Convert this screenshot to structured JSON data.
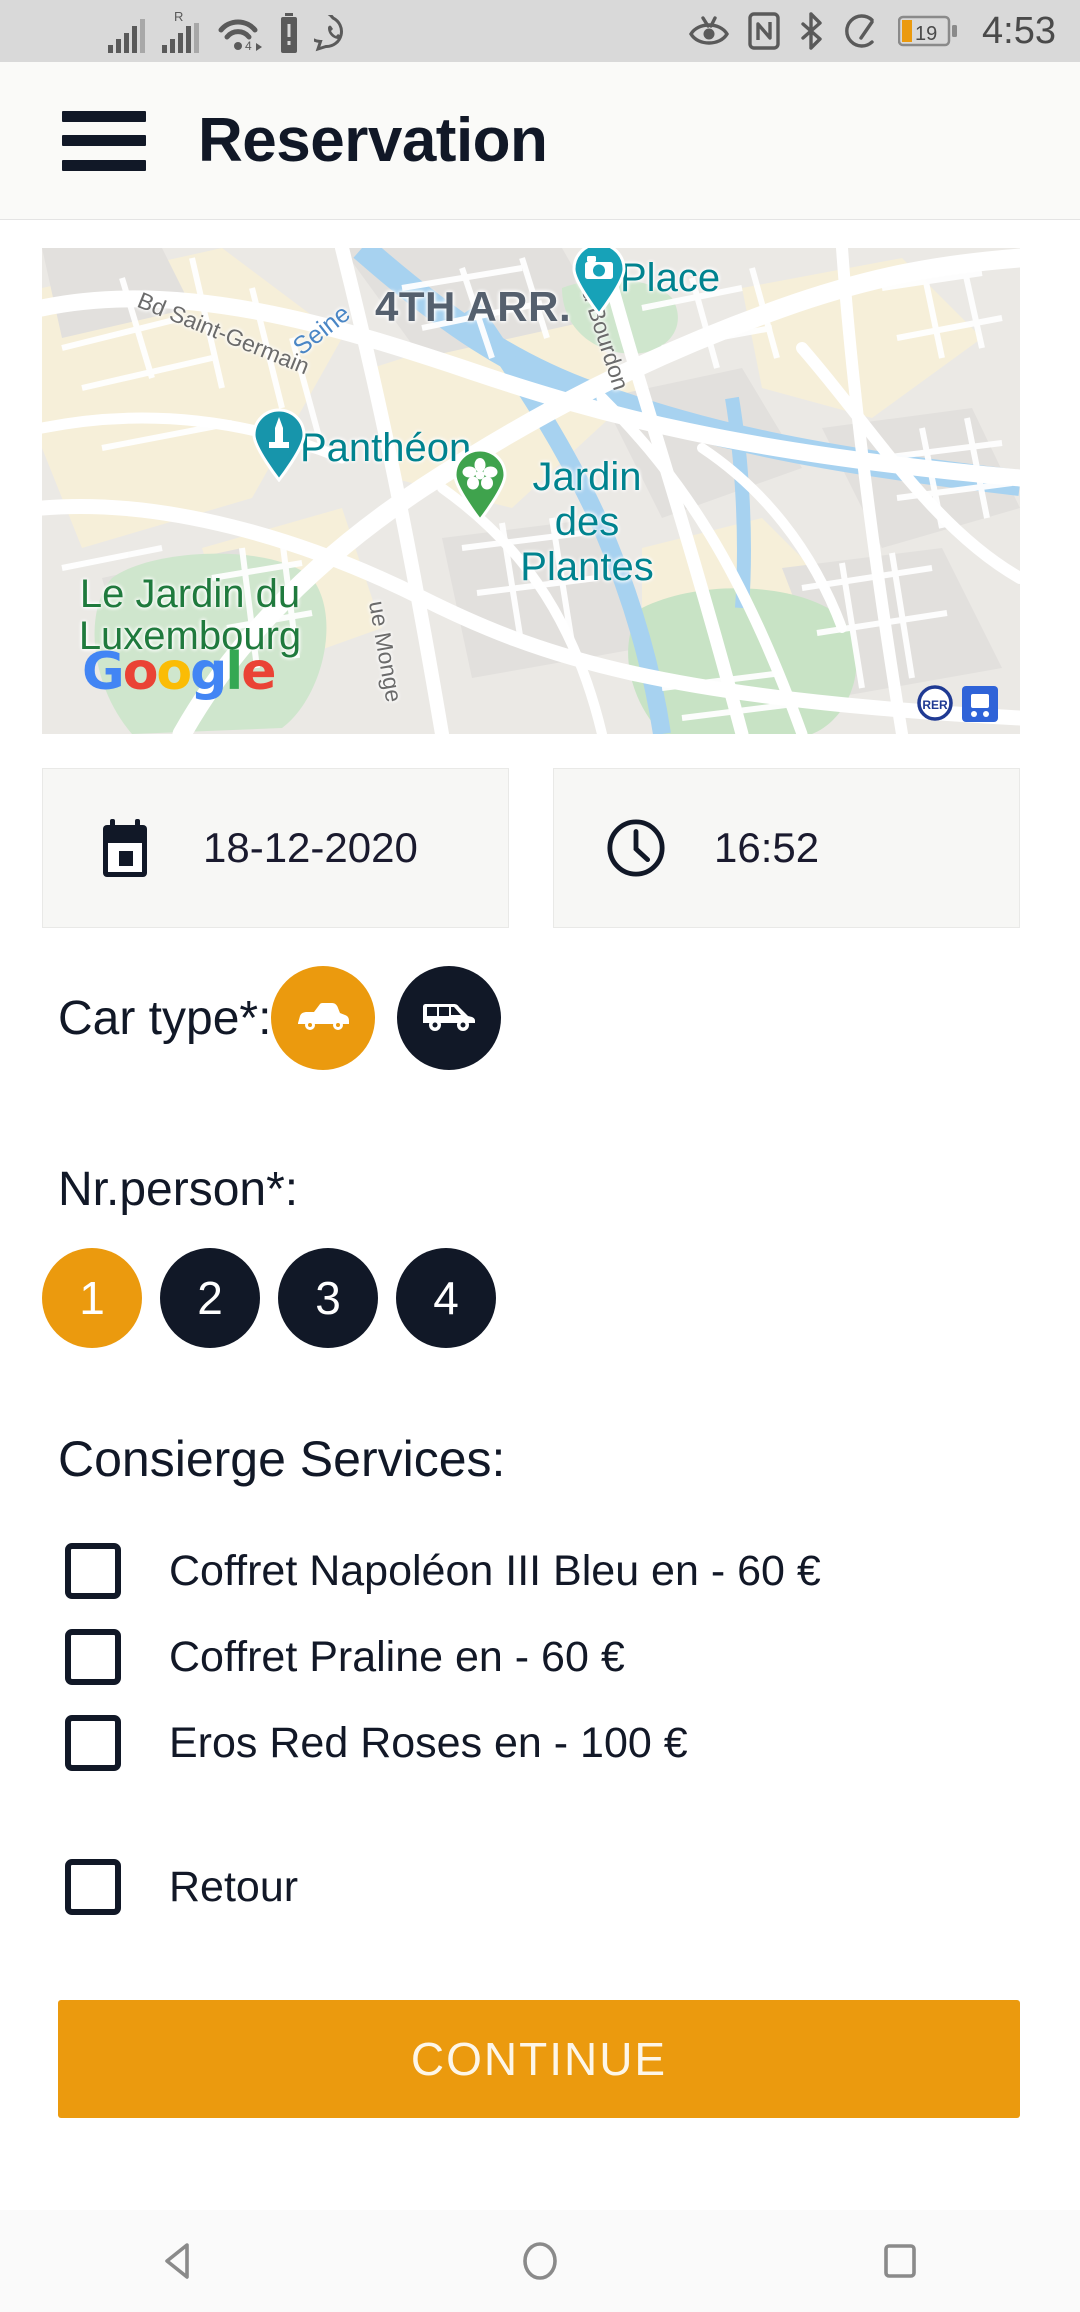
{
  "status_bar": {
    "time": "4:53",
    "battery_percent": "19",
    "icons": [
      "signal-bars-icon",
      "roaming-signal-bars-icon",
      "wifi-4g-icon",
      "battery-alert-icon",
      "whatsapp-icon",
      "eye-comfort-icon",
      "nfc-icon",
      "bluetooth-icon",
      "data-saver-icon",
      "battery-icon"
    ]
  },
  "header": {
    "title": "Reservation",
    "menu_icon": "hamburger-menu-icon"
  },
  "map": {
    "provider_logo": {
      "g1": "G",
      "o1": "o",
      "o2": "o",
      "g2": "g",
      "l": "l",
      "e": "e"
    },
    "labels": {
      "arrondissement": "4TH ARR.",
      "river": "Seine",
      "street_saint_germain": "Bd Saint-Germain",
      "street_bourdon": "Bd Bourdon",
      "street_monge": "ue Monge",
      "park_luxembourg": "Le Jardin du Luxembourg",
      "poi_pantheon": "Panthéon",
      "poi_place": "Place",
      "poi_jardin_plantes": "Jardin des Plantes"
    },
    "pins": [
      {
        "name": "place-camera-pin",
        "icon": "camera-pin-icon",
        "color": "#00a0b0"
      },
      {
        "name": "pantheon-pin",
        "icon": "monument-pin-icon",
        "color": "#00a0b0"
      },
      {
        "name": "jardin-des-plantes-pin",
        "icon": "flower-pin-icon",
        "color": "#3fa34d"
      }
    ],
    "transit_icons": [
      "rer-icon",
      "train-station-icon"
    ]
  },
  "datetime": {
    "date_icon": "calendar-icon",
    "date_value": "18-12-2020",
    "time_icon": "clock-icon",
    "time_value": "16:52"
  },
  "car_type": {
    "label": "Car type*:",
    "options": [
      {
        "name": "sedan",
        "icon": "car-sedan-icon",
        "selected": true
      },
      {
        "name": "van",
        "icon": "van-icon",
        "selected": false
      }
    ]
  },
  "nr_person": {
    "label": "Nr.person*:",
    "options": [
      "1",
      "2",
      "3",
      "4"
    ],
    "selected": "1"
  },
  "consierge": {
    "label": "Consierge Services:",
    "items": [
      {
        "label": "Coffret Napoléon III Bleu en - 60 €",
        "checked": false
      },
      {
        "label": "Coffret Praline en - 60 €",
        "checked": false
      },
      {
        "label": "Eros Red Roses en - 100 €",
        "checked": false
      }
    ],
    "retour": {
      "label": "Retour",
      "checked": false
    }
  },
  "primary_action": {
    "label": "CONTINUE"
  },
  "nav_bar": {
    "back_icon": "back-triangle-icon",
    "home_icon": "home-circle-icon",
    "recents_icon": "recents-square-icon"
  },
  "colors": {
    "accent_orange": "#eb9a0e",
    "dark_navy": "#111827",
    "status_bar_bg": "#d9d9d9",
    "appbar_bg": "#fafaf8",
    "field_bg": "#f7f7f5"
  }
}
